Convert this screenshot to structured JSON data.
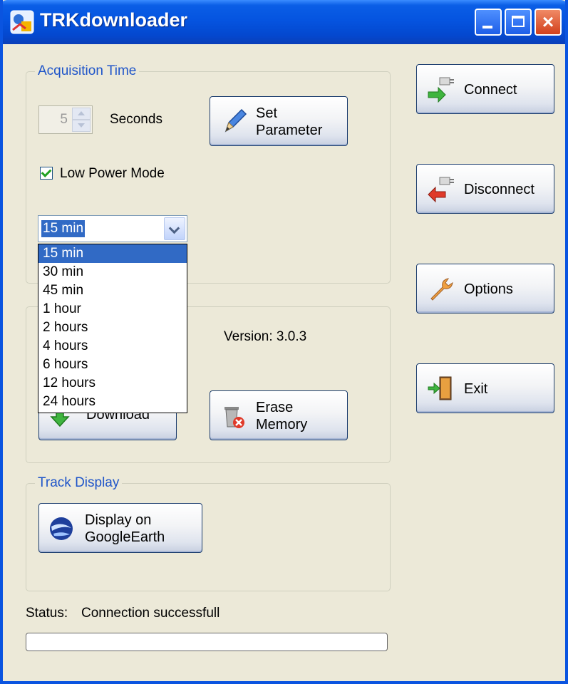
{
  "window": {
    "title": "TRKdownloader"
  },
  "acquisition": {
    "legend": "Acquisition Time",
    "seconds_value": "5",
    "seconds_label": "Seconds",
    "set_param_line1": "Set",
    "set_param_line2": "Parameter",
    "low_power_label": "Low Power Mode",
    "low_power_checked": true,
    "interval_selected": "15 min",
    "interval_options": [
      "15 min",
      "30 min",
      "45 min",
      "1 hour",
      "2 hours",
      "4 hours",
      "6 hours",
      "12 hours",
      "24 hours"
    ]
  },
  "memory": {
    "version": "Version: 3.0.3",
    "download_label": "Download",
    "erase_line1": "Erase",
    "erase_line2": "Memory"
  },
  "track": {
    "legend": "Track Display",
    "display_line1": "Display on",
    "display_line2": "GoogleEarth"
  },
  "side": {
    "connect": "Connect",
    "disconnect": "Disconnect",
    "options": "Options",
    "exit": "Exit"
  },
  "status": {
    "label": "Status:",
    "text": "Connection successfull",
    "progress_fraction": 0
  },
  "icons": [
    "app-icon",
    "pencil-icon",
    "connect-icon",
    "disconnect-icon",
    "wrench-icon",
    "exit-door-icon",
    "download-arrow-icon",
    "trash-icon",
    "globe-icon"
  ]
}
